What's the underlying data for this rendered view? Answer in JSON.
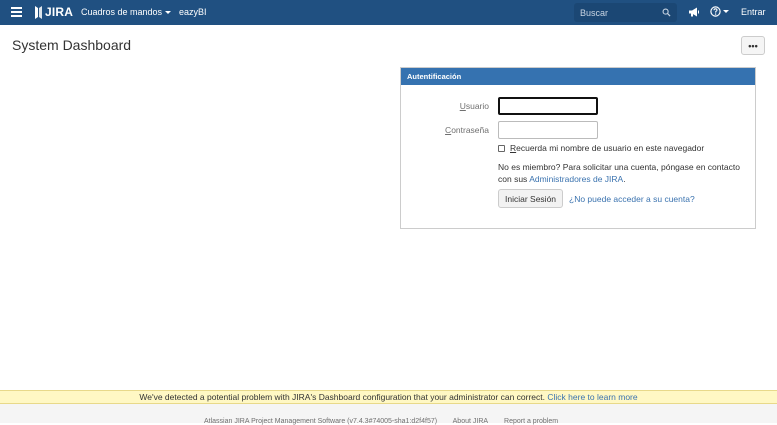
{
  "header": {
    "logo_text": "JIRA",
    "nav": {
      "dashboards": "Cuadros de mandos",
      "eazybi": "eazyBI"
    },
    "search_placeholder": "Buscar",
    "login": "Entrar"
  },
  "page": {
    "title": "System Dashboard",
    "more_label": "•••"
  },
  "login_gadget": {
    "title": "Autentificación",
    "username_label_prefix": "",
    "username_label_underline": "U",
    "username_label_rest": "suario",
    "password_label_underline": "C",
    "password_label_rest": "ontraseña",
    "username_value": "",
    "password_value": "",
    "remember_underline": "R",
    "remember_rest": "ecuerda mi nombre de usuario en este navegador",
    "info_text": "No es miembro? Para solicitar una cuenta, póngase en contacto con sus",
    "admins_link": "Administradores de JIRA",
    "info_end": ".",
    "login_button": "Iniciar Sesión",
    "forgot_link": "¿No puede acceder a su cuenta?"
  },
  "banner": {
    "message": "We've detected a potential problem with JIRA's Dashboard configuration that your administrator can correct.",
    "link": "Click here to learn more"
  },
  "footer": {
    "product": "Atlassian JIRA Project Management Software (v7.4.3#74005-sha1:d2f4f57)",
    "about": "About JIRA",
    "report": "Report a problem"
  },
  "colors": {
    "header_bg": "#205081",
    "gadget_header_bg": "#3572b0",
    "link": "#3b73af",
    "banner_bg": "#fff8c4"
  }
}
